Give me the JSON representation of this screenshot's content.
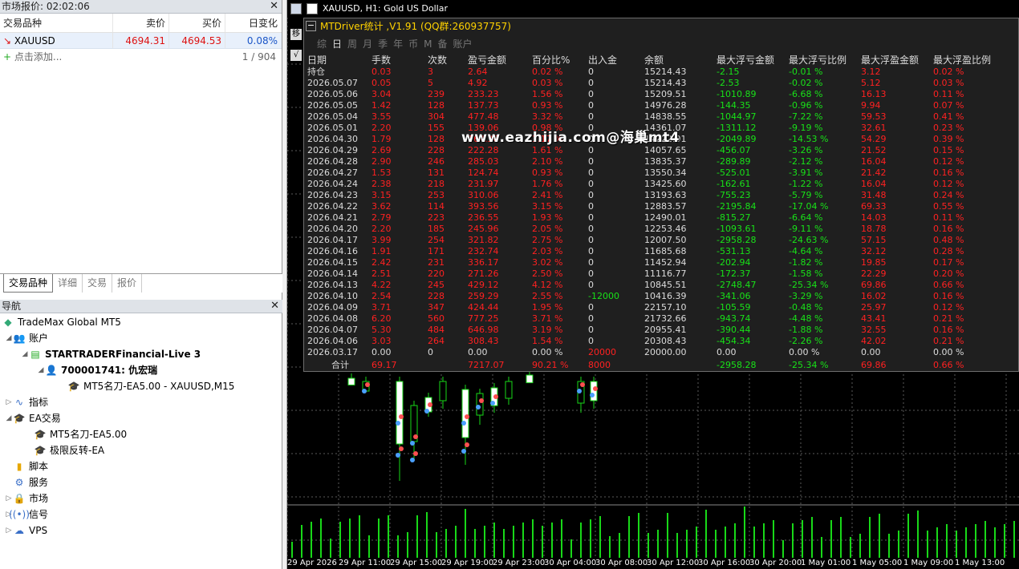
{
  "market_watch": {
    "title": "市场报价: 02:02:06",
    "columns": [
      "交易品种",
      "卖价",
      "买价",
      "日变化"
    ],
    "rows": [
      {
        "symbol": "XAUUSD",
        "bid": "4694.31",
        "ask": "4694.53",
        "change": "0.08%"
      }
    ],
    "add_text": "点击添加...",
    "count": "1 / 904",
    "tabs": [
      "交易品种",
      "详细",
      "交易",
      "报价"
    ]
  },
  "navigator": {
    "title": "导航",
    "root": "TradeMax Global MT5",
    "accounts": "账户",
    "server": "STARTRADERFinancial-Live 3",
    "account": "700001741: 仇宏瑞",
    "ea_attached": "MT5名刀-EA5.00 - XAUUSD,M15",
    "indicators": "指标",
    "ea_trading": "EA交易",
    "ea1": "MT5名刀-EA5.00",
    "ea2": "极限反转-EA",
    "scripts": "脚本",
    "services": "服务",
    "market": "市场",
    "signals": "信号",
    "vps": "VPS"
  },
  "chart": {
    "title": "XAUUSD, H1:  Gold US Dollar",
    "x_labels": [
      "29 Apr 2026",
      "29 Apr 11:00",
      "29 Apr 15:00",
      "29 Apr 19:00",
      "29 Apr 23:00",
      "30 Apr 04:00",
      "30 Apr 08:00",
      "30 Apr 12:00",
      "30 Apr 16:00",
      "30 Apr 20:00",
      "1 May 01:00",
      "1 May 05:00",
      "1 May 09:00",
      "1 May 13:00"
    ],
    "watermark": "www.eazhijia.com@海巢mt4"
  },
  "stats": {
    "title": "MTDriver统计 ,V1.91 (QQ群:260937757)",
    "tabs": [
      "综",
      "日",
      "周",
      "月",
      "季",
      "年",
      "币",
      "M",
      "备",
      "账户"
    ],
    "active_tab": "日",
    "headers": [
      "日期",
      "手数",
      "次数",
      "盈亏金额",
      "百分比%",
      "出入金",
      "余额",
      "最大浮亏金额",
      "最大浮亏比例",
      "最大浮盈金额",
      "最大浮盈比例"
    ],
    "rows": [
      [
        "持仓",
        "0.03",
        "3",
        "2.64",
        "0.02 %",
        "0",
        "15214.43",
        "-2.15",
        "-0.01 %",
        "3.12",
        "0.02 %"
      ],
      [
        "2026.05.07",
        "0.05",
        "5",
        "4.92",
        "0.03 %",
        "0",
        "15214.43",
        "-2.53",
        "-0.02 %",
        "5.12",
        "0.03 %"
      ],
      [
        "2026.05.06",
        "3.04",
        "239",
        "233.23",
        "1.56 %",
        "0",
        "15209.51",
        "-1010.89",
        "-6.68 %",
        "16.13",
        "0.11 %"
      ],
      [
        "2026.05.05",
        "1.42",
        "128",
        "137.73",
        "0.93 %",
        "0",
        "14976.28",
        "-144.35",
        "-0.96 %",
        "9.94",
        "0.07 %"
      ],
      [
        "2026.05.04",
        "3.55",
        "304",
        "477.48",
        "3.32 %",
        "0",
        "14838.55",
        "-1044.97",
        "-7.22 %",
        "59.53",
        "0.41 %"
      ],
      [
        "2026.05.01",
        "2.20",
        "155",
        "139.06",
        "0.98 %",
        "0",
        "14361.07",
        "-1311.12",
        "-9.19 %",
        "32.61",
        "0.23 %"
      ],
      [
        "2026.04.30",
        "1.79",
        "128",
        "164.36",
        "1.17 %",
        "0",
        "14222.01",
        "-2049.89",
        "-14.53 %",
        "54.29",
        "0.39 %"
      ],
      [
        "2026.04.29",
        "2.69",
        "228",
        "222.28",
        "1.61 %",
        "0",
        "14057.65",
        "-456.07",
        "-3.26 %",
        "21.52",
        "0.15 %"
      ],
      [
        "2026.04.28",
        "2.90",
        "246",
        "285.03",
        "2.10 %",
        "0",
        "13835.37",
        "-289.89",
        "-2.12 %",
        "16.04",
        "0.12 %"
      ],
      [
        "2026.04.27",
        "1.53",
        "131",
        "124.74",
        "0.93 %",
        "0",
        "13550.34",
        "-525.01",
        "-3.91 %",
        "21.42",
        "0.16 %"
      ],
      [
        "2026.04.24",
        "2.38",
        "218",
        "231.97",
        "1.76 %",
        "0",
        "13425.60",
        "-162.61",
        "-1.22 %",
        "16.04",
        "0.12 %"
      ],
      [
        "2026.04.23",
        "3.15",
        "253",
        "310.06",
        "2.41 %",
        "0",
        "13193.63",
        "-755.23",
        "-5.79 %",
        "31.48",
        "0.24 %"
      ],
      [
        "2026.04.22",
        "3.62",
        "114",
        "393.56",
        "3.15 %",
        "0",
        "12883.57",
        "-2195.84",
        "-17.04 %",
        "69.33",
        "0.55 %"
      ],
      [
        "2026.04.21",
        "2.79",
        "223",
        "236.55",
        "1.93 %",
        "0",
        "12490.01",
        "-815.27",
        "-6.64 %",
        "14.03",
        "0.11 %"
      ],
      [
        "2026.04.20",
        "2.20",
        "185",
        "245.96",
        "2.05 %",
        "0",
        "12253.46",
        "-1093.61",
        "-9.11 %",
        "18.78",
        "0.16 %"
      ],
      [
        "2026.04.17",
        "3.99",
        "254",
        "321.82",
        "2.75 %",
        "0",
        "12007.50",
        "-2958.28",
        "-24.63 %",
        "57.15",
        "0.48 %"
      ],
      [
        "2026.04.16",
        "1.91",
        "171",
        "232.74",
        "2.03 %",
        "0",
        "11685.68",
        "-531.13",
        "-4.64 %",
        "32.12",
        "0.28 %"
      ],
      [
        "2026.04.15",
        "2.42",
        "231",
        "336.17",
        "3.02 %",
        "0",
        "11452.94",
        "-202.94",
        "-1.82 %",
        "19.85",
        "0.17 %"
      ],
      [
        "2026.04.14",
        "2.51",
        "220",
        "271.26",
        "2.50 %",
        "0",
        "11116.77",
        "-172.37",
        "-1.58 %",
        "22.29",
        "0.20 %"
      ],
      [
        "2026.04.13",
        "4.22",
        "245",
        "429.12",
        "4.12 %",
        "0",
        "10845.51",
        "-2748.47",
        "-25.34 %",
        "69.86",
        "0.66 %"
      ],
      [
        "2026.04.10",
        "2.54",
        "228",
        "259.29",
        "2.55 %",
        "-12000",
        "10416.39",
        "-341.06",
        "-3.29 %",
        "16.02",
        "0.16 %"
      ],
      [
        "2026.04.09",
        "3.71",
        "347",
        "424.44",
        "1.95 %",
        "0",
        "22157.10",
        "-105.59",
        "-0.48 %",
        "25.97",
        "0.12 %"
      ],
      [
        "2026.04.08",
        "6.20",
        "560",
        "777.25",
        "3.71 %",
        "0",
        "21732.66",
        "-943.74",
        "-4.48 %",
        "43.41",
        "0.21 %"
      ],
      [
        "2026.04.07",
        "5.30",
        "484",
        "646.98",
        "3.19 %",
        "0",
        "20955.41",
        "-390.44",
        "-1.88 %",
        "32.55",
        "0.16 %"
      ],
      [
        "2026.04.06",
        "3.03",
        "264",
        "308.43",
        "1.54 %",
        "0",
        "20308.43",
        "-454.34",
        "-2.26 %",
        "42.02",
        "0.21 %"
      ],
      [
        "2026.03.17",
        "0.00",
        "0",
        "0.00",
        "0.00 %",
        "20000",
        "20000.00",
        "0.00",
        "0.00 %",
        "0.00",
        "0.00 %"
      ]
    ],
    "footer": [
      "合计",
      "69.17",
      "",
      "7217.07",
      "90.21 %",
      "8000",
      "",
      "-2958.28",
      "-25.34 %",
      "69.86",
      "0.66 %"
    ]
  },
  "colors": {
    "profit_red": "#ff2121",
    "loss_green": "#18e218",
    "title_yellow": "#ffd200",
    "chart_bg": "#000000"
  }
}
